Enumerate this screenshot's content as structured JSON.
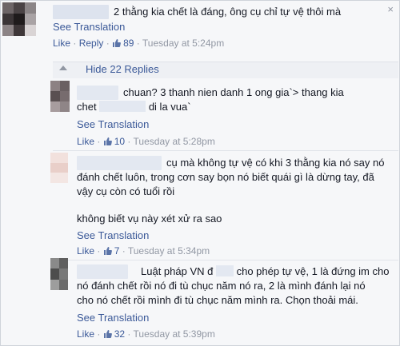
{
  "comments": [
    {
      "text": "2 thằng kia chết là đáng, ông cụ chỉ tự vệ thôi mà",
      "see_translation": "See Translation",
      "like": "Like",
      "reply": "Reply",
      "likes": "89",
      "timestamp": "Tuesday at 5:24pm"
    }
  ],
  "hide_replies": "Hide 22 Replies",
  "replies": [
    {
      "text_line1": "chuan? 3 thanh nien danh 1 ong gia`> thang kia",
      "text_line2a": "chet",
      "text_line2b": "di la vua`",
      "see_translation": "See Translation",
      "like": "Like",
      "likes": "10",
      "timestamp": "Tuesday at 5:28pm"
    },
    {
      "text_line1": "cụ mà không tự vệ có khi 3 thằng kia nó say nó",
      "text_line2": "đánh chết luôn, trong cơn say bọn nó biết quái gì là dừng tay, đã",
      "text_line3": "vậy cụ còn có tuổi rồi",
      "text_line4": "không biết vụ này xét xử ra sao",
      "see_translation": "See Translation",
      "like": "Like",
      "likes": "7",
      "timestamp": "Tuesday at 5:34pm"
    },
    {
      "text_line1a": "Luật pháp VN đ",
      "text_line1b": "cho phép tự vệ, 1 là đứng im cho",
      "text_line2": "nó đánh chết rồi nó đi tù chục năm nó ra, 2 là mình đánh lại nó",
      "text_line3": "cho nó chết rồi mình đi tù chục năm mình ra. Chọn thoải mái.",
      "see_translation": "See Translation",
      "like": "Like",
      "likes": "32",
      "timestamp": "Tuesday at 5:39pm"
    }
  ],
  "separator": "·",
  "close_glyph": "×",
  "colors": {
    "link": "#3b5998",
    "meta": "#9197a3",
    "text": "#141823",
    "background": "#f6f7f9"
  }
}
